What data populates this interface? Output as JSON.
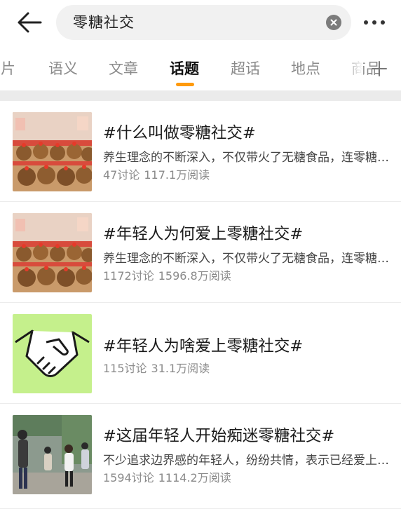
{
  "search": {
    "query": "零糖社交"
  },
  "tabs": [
    {
      "label": "图片",
      "active": false
    },
    {
      "label": "语义",
      "active": false
    },
    {
      "label": "文章",
      "active": false
    },
    {
      "label": "话题",
      "active": true
    },
    {
      "label": "超话",
      "active": false
    },
    {
      "label": "地点",
      "active": false
    },
    {
      "label": "商品",
      "active": false
    }
  ],
  "accent_color": "#ff9a0d",
  "results": [
    {
      "title": "#什么叫做零糖社交#",
      "desc": "养生理念的不断深入，不仅带火了无糖食品，连零糖社交也火了",
      "discussions": "47讨论",
      "reads": "117.1万阅读",
      "thumb": "plush-toys-photo"
    },
    {
      "title": "#年轻人为何爱上零糖社交#",
      "desc": "养生理念的不断深入，不仅带火了无糖食品，连零糖社交也火了",
      "discussions": "1172讨论",
      "reads": "1596.8万阅读",
      "thumb": "plush-toys-photo"
    },
    {
      "title": "#年轻人为啥爱上零糖社交#",
      "desc": "",
      "discussions": "115讨论",
      "reads": "31.1万阅读",
      "thumb": "handshake-icon"
    },
    {
      "title": "#这届年轻人开始痴迷零糖社交#",
      "desc": "不少追求边界感的年轻人，纷纷共情，表示已经爱上零糖社交",
      "discussions": "1594讨论",
      "reads": "1114.2万阅读",
      "thumb": "street-photo"
    }
  ]
}
